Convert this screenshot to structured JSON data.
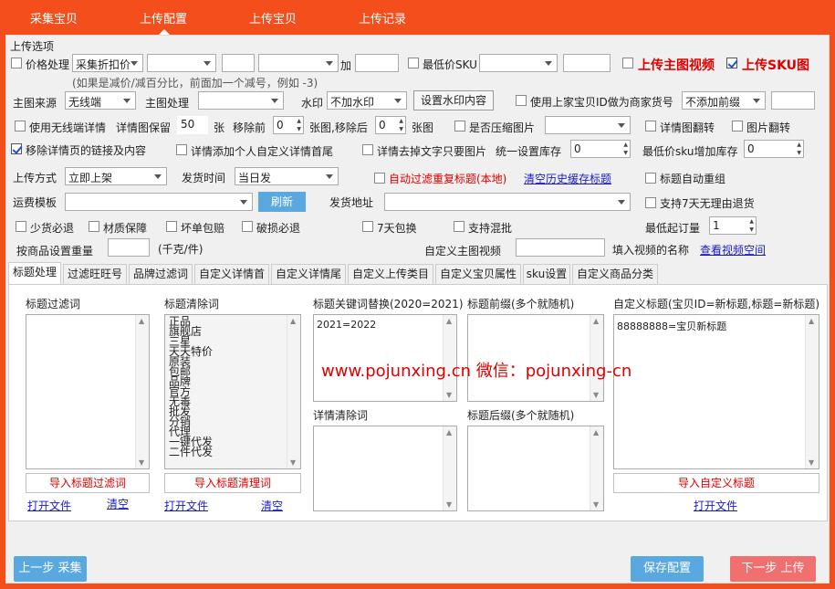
{
  "nav": {
    "tabs": [
      "采集宝贝",
      "上传配置",
      "上传宝贝",
      "上传记录"
    ]
  },
  "options": {
    "group_title": "上传选项",
    "price_label": "价格处理",
    "price_mode": "采集折扣价",
    "plus_label": "加",
    "price_hint": "(如果是减价/减百分比，前面加一个减号，例如 -3)",
    "min_sku_label": "最低价SKU",
    "upload_main_video": "上传主图视频",
    "upload_sku_image": "上传SKU图",
    "main_src_label": "主图来源",
    "main_src_value": "无线端",
    "main_proc_label": "主图处理",
    "watermark_label": "水印",
    "watermark_value": "不加水印",
    "watermark_btn": "设置水印内容",
    "use_merchant_id_label": "使用上家宝贝ID做为商家货号",
    "prefix_value": "不添加前缀",
    "use_wireless_detail": "使用无线端详情",
    "detail_keep_label": "详情图保留",
    "detail_keep_value": "50",
    "zhang": "张",
    "remove_front_label": "移除前",
    "remove_front_value": "0",
    "remove_back_label": "张图,移除后",
    "remove_back_value": "0",
    "zhang_tu": "张图",
    "compress_label": "是否压缩图片",
    "detail_flip": "详情图翻转",
    "image_flip": "图片翻转",
    "remove_links": "移除详情页的链接及内容",
    "add_custom_tail": "详情添加个人自定义详情首尾",
    "text_only_image": "详情去掉文字只要图片",
    "stock_label": "统一设置库存",
    "stock_value": "0",
    "min_sku_stock_label": "最低价sku增加库存",
    "min_sku_stock_value": "0",
    "upload_mode_label": "上传方式",
    "upload_mode_value": "立即上架",
    "ship_time_label": "发货时间",
    "ship_time_value": "当日发",
    "auto_filter_dup": "自动过滤重复标题(本地)",
    "clear_cache": "清空历史缓存标题",
    "title_regroup": "标题自动重组",
    "freight_label": "运费模板",
    "refresh_btn": "刷新",
    "ship_addr_label": "发货地址",
    "seven_day_return": "支持7天无理由退货",
    "checks_row": [
      "少货必退",
      "材质保障",
      "坏单包赔",
      "破损必退",
      "7天包换",
      "支持混批"
    ],
    "min_order_label": "最低起订量",
    "min_order_value": "1",
    "weight_label": "按商品设置重量",
    "weight_unit": "(千克/件)",
    "custom_video_label": "自定义主图视频",
    "video_name_label": "填入视频的名称",
    "view_video_space": "查看视频空间"
  },
  "tabs": [
    "标题处理",
    "过滤旺旺号",
    "品牌过滤词",
    "自定义详情首",
    "自定义详情尾",
    "自定义上传类目",
    "自定义宝贝属性",
    "sku设置",
    "自定义商品分类"
  ],
  "panel": {
    "filter_words_label": "标题过滤词",
    "clear_words_label": "标题清除词",
    "clear_words": [
      "正品",
      "旗舰店",
      "三星",
      "天天特价",
      "原装",
      "包邮",
      "品牌",
      "官方",
      "无毒",
      "批发",
      "分销",
      "代理",
      "一键代发",
      "二件代发"
    ],
    "replace_label": "标题关键词替换(2020=2021)",
    "replace_value": "2021=2022",
    "prefix_label": "标题前缀(多个就随机)",
    "custom_title_label": "自定义标题(宝贝ID=新标题,标题=新标题)",
    "custom_title_value": "88888888=宝贝新标题",
    "detail_clear_label": "详情清除词",
    "suffix_label": "标题后缀(多个就随机)",
    "import_filter_btn": "导入标题过滤词",
    "import_clear_btn": "导入标题清理词",
    "import_custom_btn": "导入自定义标题",
    "open_file": "打开文件",
    "clear": "清空",
    "watermark_text": "www.pojunxing.cn  微信：pojunxing-cn"
  },
  "footer": {
    "prev_btn": "上一步 采集",
    "save_btn": "保存配置",
    "next_btn": "下一步 上传"
  }
}
